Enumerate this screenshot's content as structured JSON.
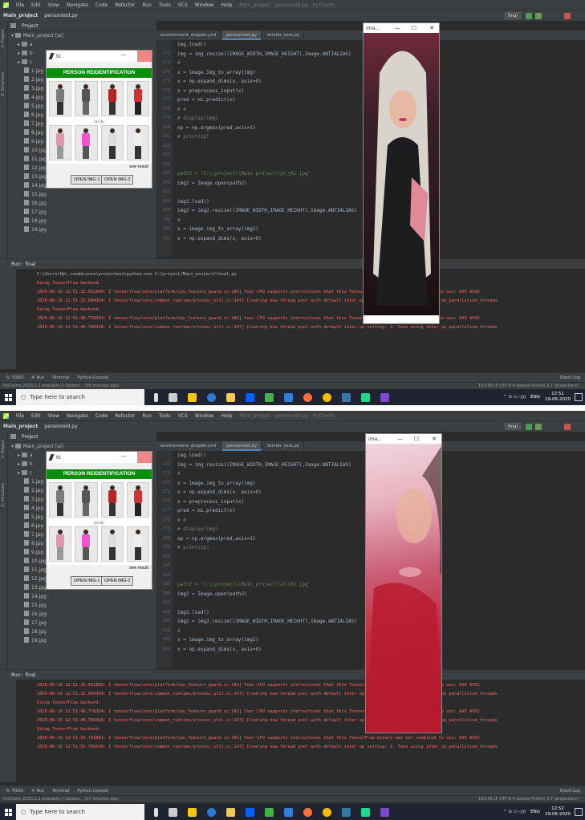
{
  "menu": [
    "File",
    "Edit",
    "View",
    "Navigate",
    "Code",
    "Refactor",
    "Run",
    "Tools",
    "VCS",
    "Window",
    "Help"
  ],
  "window_title": "Main_project - personreid.py - PyCharm",
  "breadcrumb": {
    "project": "Main_project",
    "file": "personreid.py"
  },
  "run_config": "final",
  "project_panel": {
    "title": "Project",
    "root": "Main_project [ai]",
    "root_path": "C:\\project\\Main_project",
    "folders": [
      "a",
      "b",
      "c"
    ],
    "files": [
      "1.jpg",
      "2.jpg",
      "3.jpg",
      "4.jpg",
      "5.jpg",
      "6.jpg",
      "7.jpg",
      "8.jpg",
      "9.jpg",
      "10.jpg",
      "11.jpg",
      "12.jpg",
      "13.jpg",
      "14.jpg",
      "15.jpg",
      "16.jpg",
      "17.jpg",
      "18.jpg",
      "19.jpg"
    ]
  },
  "tabs": [
    "environment_droplet.yml",
    "personreid.py",
    "tkinter_test.py"
  ],
  "line_numbers": [
    "",
    "172",
    "173",
    "174",
    "175",
    "176",
    "177",
    "178",
    "179",
    "180",
    "181",
    "182",
    "183",
    "184",
    "185",
    "186",
    "187",
    "188",
    "189",
    "190",
    "191",
    "192"
  ],
  "code_lines": [
    {
      "t": "img.load()",
      "c": ""
    },
    {
      "t": "img = img.resize((IMAGE_WIDTH,IMAGE_HEIGHT),Image.ANTIALIAS)",
      "c": ""
    },
    {
      "t": "#",
      "c": "cm"
    },
    {
      "t": "x = image.img_to_array(img)",
      "c": ""
    },
    {
      "t": "x = np.expand_dims(x, axis=0)",
      "c": ""
    },
    {
      "t": "x = preprocess_input(x)",
      "c": ""
    },
    {
      "t": "pred = m1.predict(x)",
      "c": ""
    },
    {
      "t": "# #",
      "c": "cm"
    },
    {
      "t": "# display(img)",
      "c": "cm"
    },
    {
      "t": "op = np.argmax(pred,axis=1)",
      "c": ""
    },
    {
      "t": "# print(op)",
      "c": "cm"
    },
    {
      "t": "",
      "c": ""
    },
    {
      "t": "",
      "c": ""
    },
    {
      "t": "",
      "c": ""
    },
    {
      "t": "path2 = \"C:\\\\project\\\\Main_project\\\\b\\\\01.jpg\"",
      "c": "str"
    },
    {
      "t": "img2 = Image.open(path2)",
      "c": ""
    },
    {
      "t": "",
      "c": ""
    },
    {
      "t": "img2.load()",
      "c": ""
    },
    {
      "t": "img2 = img2.resize((IMAGE_WIDTH,IMAGE_HEIGHT),Image.ANTIALIAS)",
      "c": ""
    },
    {
      "t": "#",
      "c": "cm"
    },
    {
      "t": "x = image.img_to_array(img2)",
      "c": ""
    },
    {
      "t": "x = np.expand_dims(x, axis=0)",
      "c": ""
    }
  ],
  "run_tab": "final",
  "console1": [
    {
      "t": "C:\\Users\\Hp\\.conda\\envs\\projectenv\\python.exe C:/project/Main_project/final.py",
      "c": "out"
    },
    {
      "t": "Using TensorFlow backend.",
      "c": "err"
    },
    {
      "t": "2020-06-19 12:51:32.681869: I tensorflow/core/platform/cpu_feature_guard.cc:142] Your CPU supports instructions that this TensorFlow binary was not compiled to use: AVX AVX2",
      "c": "err"
    },
    {
      "t": "2020-06-19 12:51:32.684364: I tensorflow/core/common_runtime/process_util.cc:147] Creating new thread pool with default inter op setting: 2. Tune using inter_op_parallelism_threads",
      "c": "err"
    },
    {
      "t": "Using TensorFlow backend.",
      "c": "err"
    },
    {
      "t": "2020-06-19 12:51:40.778394: I tensorflow/core/platform/cpu_feature_guard.cc:142] Your CPU supports instructions that this TensorFlow binary was not compiled to use: AVX AVX2",
      "c": "err"
    },
    {
      "t": "2020-06-19 12:51:40.780418: I tensorflow/core/common_runtime/process_util.cc:147] Creating new thread pool with default inter op setting: 2. Tune using inter_op_parallelism_threads",
      "c": "err"
    }
  ],
  "console2": [
    {
      "t": "2020-06-19 12:51:32.681869: I tensorflow/core/platform/cpu_feature_guard.cc:142] Your CPU supports instructions that this TensorFlow binary was not compiled to use: AVX AVX2",
      "c": "err"
    },
    {
      "t": "2020-06-19 12:51:32.684364: I tensorflow/core/common_runtime/process_util.cc:147] Creating new thread pool with default inter op setting: 2. Tune using inter_op_parallelism_threads",
      "c": "err"
    },
    {
      "t": "Using TensorFlow backend.",
      "c": "err"
    },
    {
      "t": "2020-06-19 12:51:40.778394: I tensorflow/core/platform/cpu_feature_guard.cc:142] Your CPU supports instructions that this TensorFlow binary was not compiled to use: AVX AVX2",
      "c": "err"
    },
    {
      "t": "2020-06-19 12:51:40.780418: I tensorflow/core/common_runtime/process_util.cc:147] Creating new thread pool with default inter op setting: 2. Tune using inter_op_parallelism_threads",
      "c": "err"
    },
    {
      "t": "Using TensorFlow backend.",
      "c": "err"
    },
    {
      "t": "2020-06-19 12:51:55.793881: I tensorflow/core/platform/cpu_feature_guard.cc:142] Your CPU supports instructions that this TensorFlow binary was not compiled to use: AVX AVX2",
      "c": "err"
    },
    {
      "t": "2020-06-19 12:51:55.796638: I tensorflow/core/common_runtime/process_util.cc:147] Creating new thread pool with default inter op setting: 2. Tune using inter_op_parallelism_threads",
      "c": "err"
    }
  ],
  "tool_windows": [
    "6: TODO",
    "4: Run",
    "Terminal",
    "Python Console"
  ],
  "event_log": "Event Log",
  "status1": {
    "left": "PyCharm 2020.1.2 available // Update... (36 minutes ago)",
    "right": "103:38  LF  UTF-8  4 spaces  Python 3.7 (projectenv)"
  },
  "status2": {
    "left": "PyCharm 2020.1.2 available // Update... (37 minutes ago)",
    "right": "103:38  LF  UTF-8  4 spaces  Python 3.7 (projectenv)"
  },
  "taskbar": {
    "search_placeholder": "Type here to search",
    "lang": "ENG",
    "time1": "12:51",
    "time2": "12:52",
    "date": "19-06-2020"
  },
  "tk_app": {
    "title": "tk",
    "banner": "PERSON REIDENTIFICATION",
    "see_result": "see result",
    "btn1": "OPEN IMG-1",
    "btn2": "OPEN IMG-2",
    "sublabels": [
      "(a)",
      "(b)",
      "(c)",
      "(d)"
    ]
  },
  "img_window": {
    "title1": "ima...",
    "title2": "ima...",
    "min": "—",
    "max": "☐",
    "close": "✕"
  },
  "colors": {
    "banner": "#0b8d0b",
    "error": "#ff6b68",
    "editor_bg": "#2b2b2b",
    "panel_bg": "#3c3f41"
  }
}
